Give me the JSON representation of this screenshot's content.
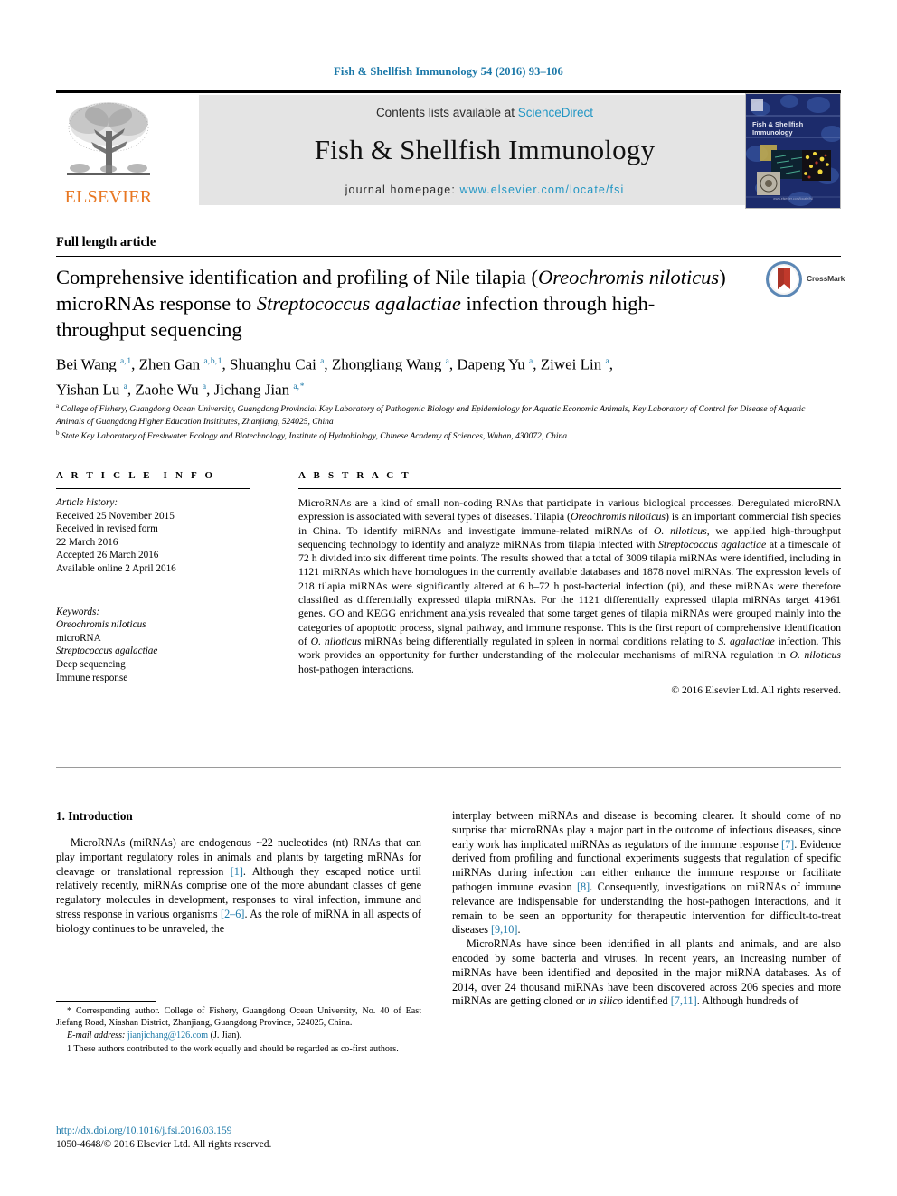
{
  "running_head": "Fish & Shellfish Immunology 54 (2016) 93–106",
  "masthead": {
    "contents_prefix": "Contents lists available at ",
    "sciencedirect": "ScienceDirect",
    "journal_title": "Fish & Shellfish Immunology",
    "homepage_prefix": "journal homepage: ",
    "homepage_url": "www.elsevier.com/locate/fsi",
    "publisher": "ELSEVIER",
    "cover_title": "Fish & Shellfish\nImmunology",
    "cover_footer": "www.elsevier.com/locate/fsi",
    "accent_link_color": "#2196c4",
    "header_color": "#1b78a8",
    "elsevier_orange": "#E87722",
    "cover_bg": "#1c2b6b"
  },
  "article_type": "Full length article",
  "title": {
    "line1_a": "Comprehensive identification and profiling of Nile tilapia (",
    "line1_i": "Oreochromis",
    "line2_i": "niloticus",
    "line2_a": ") microRNAs response to ",
    "line2_i2": "Streptococcus agalactiae",
    "line2_b": " infection",
    "line3": "through high-throughput sequencing"
  },
  "crossmark": {
    "label": "CrossMark"
  },
  "authors": {
    "list": "Bei Wang a,1, Zhen Gan a, b,1, Shuanghu Cai a, Zhongliang Wang a, Dapeng Yu a, Ziwei Lin a, Yishan Lu a, Zaohe Wu a, Jichang Jian a,*",
    "affiliation_a": "a College of Fishery, Guangdong Ocean University, Guangdong Provincial Key Laboratory of Pathogenic Biology and Epidemiology for Aquatic Economic Animals, Key Laboratory of Control for Disease of Aquatic Animals of Guangdong Higher Education Insititutes, Zhanjiang, 524025, China",
    "affiliation_b": "b State Key Laboratory of Freshwater Ecology and Biotechnology, Institute of Hydrobiology, Chinese Academy of Sciences, Wuhan, 430072, China"
  },
  "article_info": {
    "heading": "ARTICLE INFO",
    "history_label": "Article history:",
    "history": [
      "Received 25 November 2015",
      "Received in revised form",
      "22 March 2016",
      "Accepted 26 March 2016",
      "Available online 2 April 2016"
    ],
    "keywords_label": "Keywords:",
    "keywords": [
      "Oreochromis niloticus",
      "microRNA",
      "Streptococcus agalactiae",
      "Deep sequencing",
      "Immune response"
    ]
  },
  "abstract": {
    "heading": "ABSTRACT",
    "text": "MicroRNAs are a kind of small non-coding RNAs that participate in various biological processes. Deregulated microRNA expression is associated with several types of diseases. Tilapia (Oreochromis niloticus) is an important commercial fish species in China. To identify miRNAs and investigate immune-related miRNAs of O. niloticus, we applied high-throughput sequencing technology to identify and analyze miRNAs from tilapia infected with Streptococcus agalactiae at a timescale of 72 h divided into six different time points. The results showed that a total of 3009 tilapia miRNAs were identified, including in 1121 miRNAs which have homologues in the currently available databases and 1878 novel miRNAs. The expression levels of 218 tilapia miRNAs were significantly altered at 6 h–72 h post-bacterial infection (pi), and these miRNAs were therefore classified as differentially expressed tilapia miRNAs. For the 1121 differentially expressed tilapia miRNAs target 41961 genes. GO and KEGG enrichment analysis revealed that some target genes of tilapia miRNAs were grouped mainly into the categories of apoptotic process, signal pathway, and immune response. This is the first report of comprehensive identification of O. niloticus miRNAs being differentially regulated in spleen in normal conditions relating to S. agalactiae infection. This work provides an opportunity for further understanding of the molecular mechanisms of miRNA regulation in O. niloticus host-pathogen interactions.",
    "copyright": "© 2016 Elsevier Ltd. All rights reserved."
  },
  "body": {
    "section_heading": "1. Introduction",
    "para_left_1": "MicroRNAs (miRNAs) are endogenous ~22 nucleotides (nt) RNAs that can play important regulatory roles in animals and plants by targeting mRNAs for cleavage or translational repression [1]. Although they escaped notice until relatively recently, miRNAs comprise one of the more abundant classes of gene regulatory molecules in development, responses to viral infection, immune and stress response in various organisms [2–6]. As the role of miRNA in all aspects of biology continues to be unraveled, the",
    "para_right_1": "interplay between miRNAs and disease is becoming clearer. It should come of no surprise that microRNAs play a major part in the outcome of infectious diseases, since early work has implicated miRNAs as regulators of the immune response [7]. Evidence derived from profiling and functional experiments suggests that regulation of specific miRNAs during infection can either enhance the immune response or facilitate pathogen immune evasion [8]. Consequently, investigations on miRNAs of immune relevance are indispensable for understanding the host-pathogen interactions, and it remain to be seen an opportunity for therapeutic intervention for difficult-to-treat diseases [9,10].",
    "para_right_2": "MicroRNAs have since been identified in all plants and animals, and are also encoded by some bacteria and viruses. In recent years, an increasing number of miRNAs have been identified and deposited in the major miRNA databases. As of 2014, over 24 thousand miRNAs have been discovered across 206 species and more miRNAs are getting cloned or in silico identified [7,11]. Although hundreds of",
    "ref_1": "[1]",
    "ref_2_6": "[2–6]",
    "ref_7": "[7]",
    "ref_8": "[8]",
    "ref_9_10": "[9,10]",
    "ref_7_11": "[7,11]"
  },
  "footnotes": {
    "corresponding": "* Corresponding author. College of Fishery, Guangdong Ocean University, No. 40 of East Jiefang Road, Xiashan District, Zhanjiang, Guangdong Province, 524025, China.",
    "email_label": "E-mail address:",
    "email": "jianjichang@126.com",
    "email_suffix": "(J. Jian).",
    "equal_contrib": "1 These authors contributed to the work equally and should be regarded as co-first authors."
  },
  "doi": {
    "url": "http://dx.doi.org/10.1016/j.fsi.2016.03.159",
    "issn_line": "1050-4648/© 2016 Elsevier Ltd. All rights reserved."
  }
}
